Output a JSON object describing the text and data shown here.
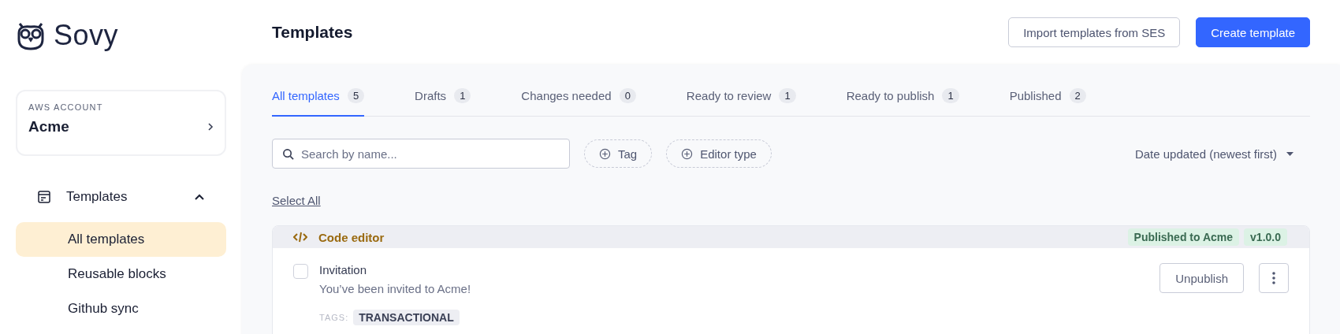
{
  "brand": {
    "name": "Sovy"
  },
  "account": {
    "label": "AWS ACCOUNT",
    "name": "Acme"
  },
  "nav": {
    "label": "Templates",
    "expanded": true,
    "children": [
      {
        "label": "All templates",
        "selected": true
      },
      {
        "label": "Reusable blocks",
        "selected": false
      },
      {
        "label": "Github sync",
        "selected": false
      }
    ]
  },
  "page": {
    "title": "Templates",
    "buttons": [
      {
        "label": "Import templates from SES",
        "kind": "secondary"
      },
      {
        "label": "Create template",
        "kind": "primary"
      }
    ]
  },
  "tabs": [
    {
      "label": "All templates",
      "count": "5",
      "selected": true
    },
    {
      "label": "Drafts",
      "count": "1",
      "selected": false
    },
    {
      "label": "Changes needed",
      "count": "0",
      "selected": false
    },
    {
      "label": "Ready to review",
      "count": "1",
      "selected": false
    },
    {
      "label": "Ready to publish",
      "count": "1",
      "selected": false
    },
    {
      "label": "Published",
      "count": "2",
      "selected": false
    }
  ],
  "search": {
    "placeholder": "Search by name..."
  },
  "filters": [
    "Tag",
    "Editor type"
  ],
  "sort": {
    "value": "Date updated (newest first)"
  },
  "select_all": "Select All",
  "groups": [
    {
      "editor": "Code editor",
      "status": "Published to Acme",
      "version": "v1.0.0",
      "items": [
        {
          "name": "Invitation",
          "subject": "You’ve been invited to Acme!",
          "checked": false,
          "tags_label": "TAGS:",
          "tags": [
            "TRANSACTIONAL"
          ],
          "action": "Unpublish"
        }
      ]
    }
  ]
}
